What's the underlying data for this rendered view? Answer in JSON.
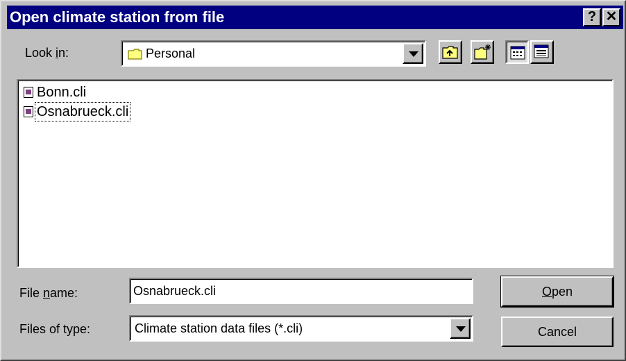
{
  "window": {
    "title": "Open climate station from file",
    "help_label": "?",
    "close_label": "✕"
  },
  "look_in": {
    "label_pre": "Look ",
    "label_key": "i",
    "label_post": "n:",
    "value": "Personal"
  },
  "toolbar": {
    "up_icon": "up-folder-icon",
    "new_folder_icon": "new-folder-icon",
    "list_icon": "list-view-icon",
    "details_icon": "details-view-icon"
  },
  "files": [
    {
      "name": "Bonn.cli"
    },
    {
      "name": "Osnabrueck.cli"
    }
  ],
  "file_name": {
    "label_pre": "File ",
    "label_key": "n",
    "label_post": "ame:",
    "value": "Osnabrueck.cli"
  },
  "file_type": {
    "label": "Files of type:",
    "value": "Climate station data files (*.cli)"
  },
  "buttons": {
    "open_key": "O",
    "open_rest": "pen",
    "cancel": "Cancel"
  }
}
